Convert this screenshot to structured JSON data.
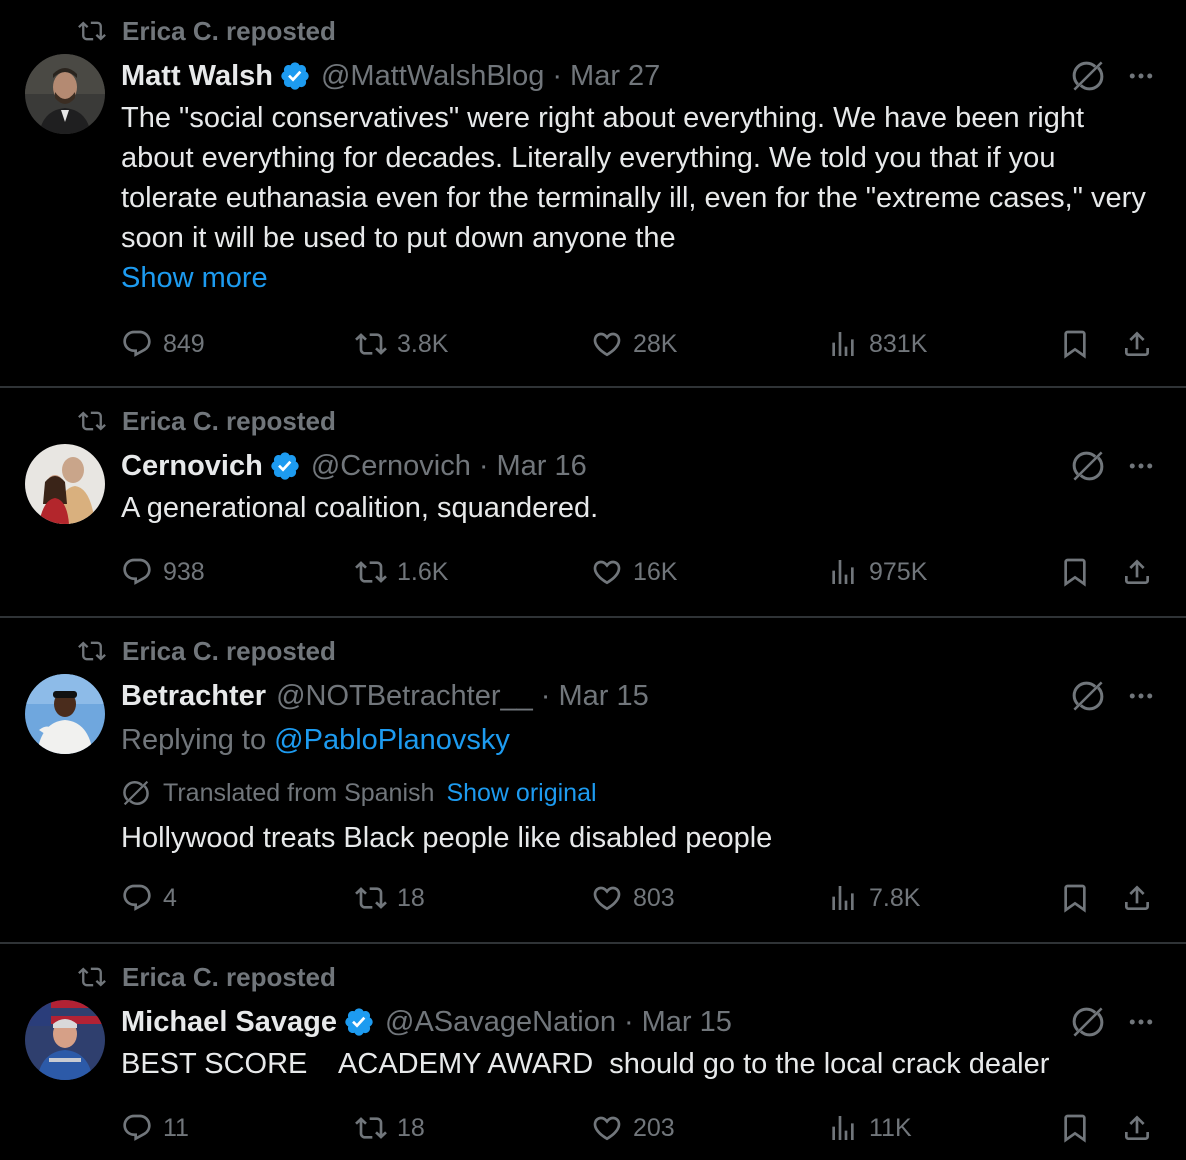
{
  "tweets": [
    {
      "repost_label": "Erica C. reposted",
      "name": "Matt Walsh",
      "verified": true,
      "handle": "@MattWalshBlog",
      "separator": "·",
      "date": "Mar 27",
      "text": "The \"social conservatives\" were right about everything. We have been right about everything for decades. Literally everything. We told you that if you tolerate euthanasia even for the terminally ill, even for the \"extreme cases,\" very soon it will be used to put down anyone the",
      "show_more": "Show more",
      "replies": "849",
      "reposts": "3.8K",
      "likes": "28K",
      "views": "831K"
    },
    {
      "repost_label": "Erica C. reposted",
      "name": "Cernovich",
      "verified": true,
      "handle": "@Cernovich",
      "separator": "·",
      "date": "Mar 16",
      "text": "A generational coalition, squandered.",
      "replies": "938",
      "reposts": "1.6K",
      "likes": "16K",
      "views": "975K"
    },
    {
      "repost_label": "Erica C. reposted",
      "name": "Betrachter",
      "verified": false,
      "handle": "@NOTBetrachter__",
      "separator": "·",
      "date": "Mar 15",
      "replying_prefix": "Replying to",
      "replying_to": "@PabloPlanovsky",
      "translated_label": "Translated from Spanish",
      "show_original": "Show original",
      "text": "Hollywood treats Black people like disabled people",
      "replies": "4",
      "reposts": "18",
      "likes": "803",
      "views": "7.8K"
    },
    {
      "repost_label": "Erica C. reposted",
      "name": "Michael Savage",
      "verified": true,
      "handle": "@ASavageNation",
      "separator": "·",
      "date": "Mar 15",
      "text": "BEST SCORE    ACADEMY AWARD  should go to the local crack dealer",
      "replies": "11",
      "reposts": "18",
      "likes": "203",
      "views": "11K"
    }
  ],
  "colors": {
    "background": "#000000",
    "text": "#e7e9ea",
    "secondary": "#71767b",
    "link": "#1d9bf0",
    "divider": "#2f3336",
    "verified": "#1d9bf0"
  },
  "icons": [
    "repost-icon",
    "verified-badge-icon",
    "grok-icon",
    "more-icon",
    "reply-icon",
    "like-icon",
    "views-icon",
    "bookmark-icon",
    "share-icon",
    "translate-icon"
  ]
}
